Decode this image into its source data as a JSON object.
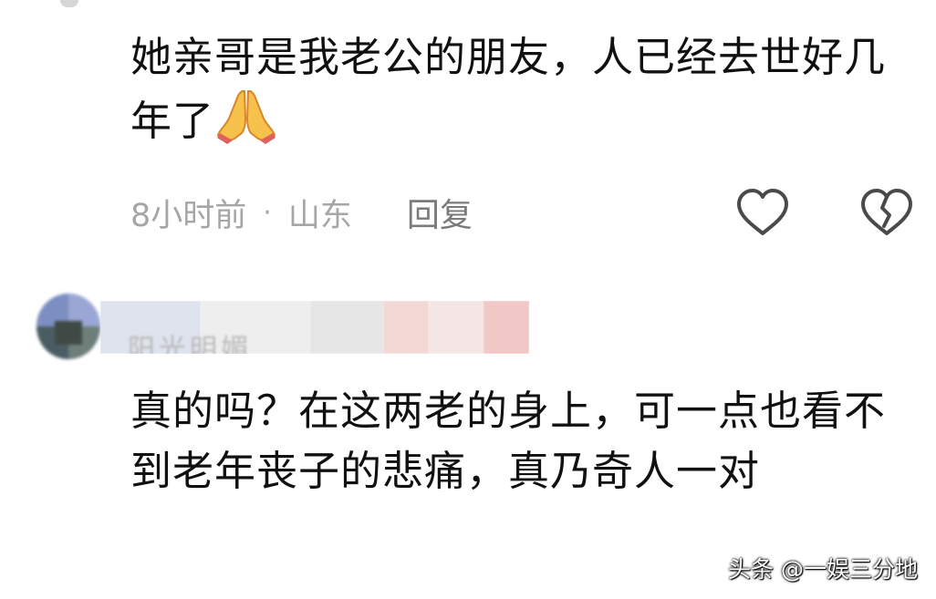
{
  "comment1": {
    "text": "她亲哥是我老公的朋友，人已经去世好几年了",
    "emoji": "folded-hands",
    "time": "8小时前",
    "separator": "·",
    "location": "山东",
    "reply_label": "回复"
  },
  "comment2": {
    "username": "阳光明媚",
    "text": "真的吗？在这两老的身上，可一点也看不到老年丧子的悲痛，真乃奇人一对"
  },
  "watermark": "头条 @一娱三分地",
  "colors": {
    "meta_text": "#a6a6a6",
    "reply_text": "#7b7b7b",
    "body_text": "#111111",
    "icon_stroke": "#4a4a4a"
  },
  "icons": {
    "like": "heart-outline-icon",
    "dislike": "broken-heart-icon",
    "emoji": "folded-hands-emoji"
  }
}
